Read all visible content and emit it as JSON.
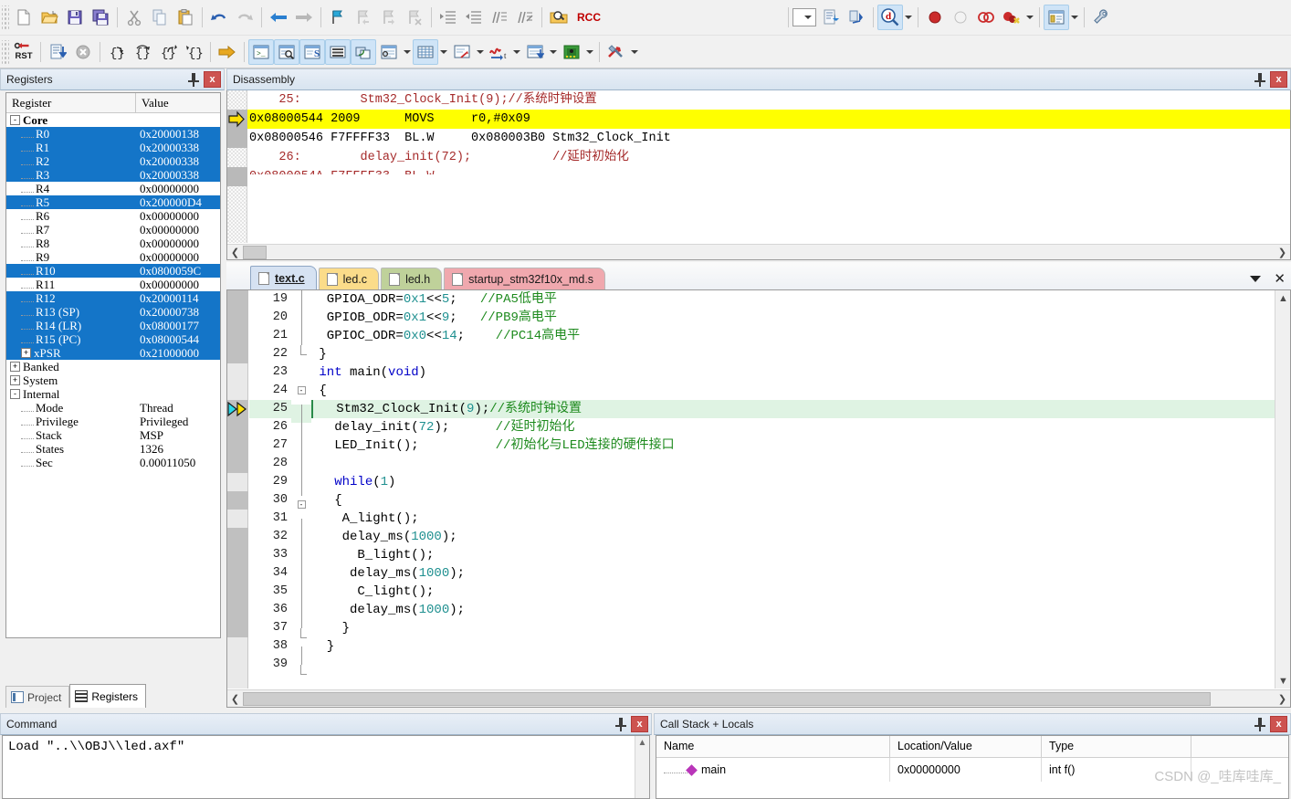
{
  "toolbar_main": {
    "groups": [
      {
        "items": [
          {
            "name": "new-file-icon",
            "label": "New"
          },
          {
            "name": "open-file-icon",
            "label": "Open"
          },
          {
            "name": "save-icon",
            "label": "Save"
          },
          {
            "name": "save-all-icon",
            "label": "Save All"
          }
        ]
      },
      {
        "items": [
          {
            "name": "cut-icon",
            "label": "Cut"
          },
          {
            "name": "copy-icon",
            "label": "Copy"
          },
          {
            "name": "paste-icon",
            "label": "Paste"
          }
        ]
      },
      {
        "items": [
          {
            "name": "undo-icon",
            "label": "Undo"
          },
          {
            "name": "redo-icon",
            "label": "Redo"
          }
        ]
      },
      {
        "items": [
          {
            "name": "navigate-back-icon",
            "label": "Back"
          },
          {
            "name": "navigate-forward-icon",
            "label": "Forward"
          }
        ]
      },
      {
        "items": [
          {
            "name": "bookmark-toggle-icon",
            "label": "Toggle Bookmark"
          },
          {
            "name": "bookmark-prev-icon",
            "label": "Previous Bookmark"
          },
          {
            "name": "bookmark-next-icon",
            "label": "Next Bookmark"
          },
          {
            "name": "bookmark-clear-icon",
            "label": "Clear All Bookmarks"
          }
        ]
      },
      {
        "items": [
          {
            "name": "indent-icon",
            "label": "Indent"
          },
          {
            "name": "outdent-icon",
            "label": "Outdent"
          },
          {
            "name": "comment-icon",
            "label": "Comment"
          },
          {
            "name": "uncomment-icon",
            "label": "Uncomment"
          }
        ]
      },
      {
        "items": [
          {
            "name": "find-in-files-icon",
            "label": "Find in Files"
          }
        ]
      }
    ],
    "search_box_value": "RCC",
    "right_group": [
      {
        "name": "code-completion-combo-icon",
        "label": "Configure"
      },
      {
        "name": "insert-breakpoint-icon",
        "label": "Insert/Remove Breakpoint"
      },
      {
        "name": "enable-breakpoint-icon",
        "label": "Enable/Disable Breakpoint"
      },
      {
        "name": "disable-all-breakpoints-icon",
        "label": "Disable All Breakpoints"
      },
      {
        "name": "kill-all-breakpoints-icon",
        "label": "Kill All Breakpoints"
      },
      {
        "name": "manage-windows-icon",
        "label": "Manage Windows"
      },
      {
        "name": "configure-target-icon",
        "label": "Configure Target"
      }
    ]
  },
  "toolbar_debug": {
    "items": [
      {
        "name": "reset-cpu-icon",
        "label": "RST",
        "active": false
      },
      {
        "name": "run-icon",
        "label": "Run",
        "active": false
      },
      {
        "name": "stop-icon",
        "label": "Stop",
        "active": false
      },
      {
        "name": "step-into-icon",
        "label": "Step",
        "active": false
      },
      {
        "name": "step-over-icon",
        "label": "Step Over",
        "active": false
      },
      {
        "name": "step-out-icon",
        "label": "Step Out",
        "active": false
      },
      {
        "name": "run-to-cursor-icon",
        "label": "Run to Cursor Line",
        "active": false
      },
      {
        "name": "show-next-statement-icon",
        "label": "Show Next Statement",
        "active": false
      },
      {
        "name": "command-window-icon",
        "label": "Command Window",
        "active": true
      },
      {
        "name": "disassembly-window-icon",
        "label": "Disassembly Window",
        "active": true
      },
      {
        "name": "symbols-window-icon",
        "label": "Symbols Window",
        "active": true
      },
      {
        "name": "registers-window-icon",
        "label": "Registers Window",
        "active": true
      },
      {
        "name": "call-stack-window-icon",
        "label": "Call Stack Window",
        "active": true
      },
      {
        "name": "watch-windows-icon",
        "label": "Watch Windows",
        "active": false
      },
      {
        "name": "memory-windows-icon",
        "label": "Memory Windows",
        "active": true
      },
      {
        "name": "serial-windows-icon",
        "label": "Serial Windows",
        "active": false
      },
      {
        "name": "analysis-windows-icon",
        "label": "Analysis Windows",
        "active": false
      },
      {
        "name": "trace-windows-icon",
        "label": "Trace Windows",
        "active": false
      },
      {
        "name": "system-viewer-icon",
        "label": "System Viewer",
        "active": false
      },
      {
        "name": "toolbox-icon",
        "label": "Debug Toolbox",
        "active": false
      }
    ]
  },
  "registers_panel": {
    "title": "Registers",
    "columns": [
      "Register",
      "Value"
    ],
    "rows": [
      {
        "name": "Core",
        "value": "",
        "group": true,
        "expander": "-",
        "indent": 0,
        "selected": false
      },
      {
        "name": "R0",
        "value": "0x20000138",
        "indent": 2,
        "selected": true
      },
      {
        "name": "R1",
        "value": "0x20000338",
        "indent": 2,
        "selected": true
      },
      {
        "name": "R2",
        "value": "0x20000338",
        "indent": 2,
        "selected": true
      },
      {
        "name": "R3",
        "value": "0x20000338",
        "indent": 2,
        "selected": true
      },
      {
        "name": "R4",
        "value": "0x00000000",
        "indent": 2,
        "selected": false
      },
      {
        "name": "R5",
        "value": "0x200000D4",
        "indent": 2,
        "selected": true
      },
      {
        "name": "R6",
        "value": "0x00000000",
        "indent": 2,
        "selected": false
      },
      {
        "name": "R7",
        "value": "0x00000000",
        "indent": 2,
        "selected": false
      },
      {
        "name": "R8",
        "value": "0x00000000",
        "indent": 2,
        "selected": false
      },
      {
        "name": "R9",
        "value": "0x00000000",
        "indent": 2,
        "selected": false
      },
      {
        "name": "R10",
        "value": "0x0800059C",
        "indent": 2,
        "selected": true
      },
      {
        "name": "R11",
        "value": "0x00000000",
        "indent": 2,
        "selected": false
      },
      {
        "name": "R12",
        "value": "0x20000114",
        "indent": 2,
        "selected": true
      },
      {
        "name": "R13 (SP)",
        "value": "0x20000738",
        "indent": 2,
        "selected": true
      },
      {
        "name": "R14 (LR)",
        "value": "0x08000177",
        "indent": 2,
        "selected": true
      },
      {
        "name": "R15 (PC)",
        "value": "0x08000544",
        "indent": 2,
        "selected": true
      },
      {
        "name": "xPSR",
        "value": "0x21000000",
        "indent": 2,
        "selected": true,
        "expander": "+"
      },
      {
        "name": "Banked",
        "value": "",
        "indent": 0,
        "expander": "+",
        "selected": false
      },
      {
        "name": "System",
        "value": "",
        "indent": 0,
        "expander": "+",
        "selected": false
      },
      {
        "name": "Internal",
        "value": "",
        "indent": 0,
        "expander": "-",
        "selected": false
      },
      {
        "name": "Mode",
        "value": "Thread",
        "indent": 2,
        "selected": false
      },
      {
        "name": "Privilege",
        "value": "Privileged",
        "indent": 2,
        "selected": false
      },
      {
        "name": "Stack",
        "value": "MSP",
        "indent": 2,
        "selected": false
      },
      {
        "name": "States",
        "value": "1326",
        "indent": 2,
        "selected": false
      },
      {
        "name": "Sec",
        "value": "0.00011050",
        "indent": 2,
        "selected": false
      }
    ]
  },
  "left_tabs": [
    {
      "label": "Project",
      "icon": "project-icon",
      "active": false
    },
    {
      "label": "Registers",
      "icon": "registers-icon",
      "active": true
    }
  ],
  "disassembly_panel": {
    "title": "Disassembly",
    "lines": [
      {
        "kind": "source",
        "text": "    25:        Stm32_Clock_Init(9);//系统时钟设置",
        "current": false
      },
      {
        "kind": "asm",
        "text": "0x08000544 2009      MOVS     r0,#0x09",
        "current": true
      },
      {
        "kind": "asm",
        "text": "0x08000546 F7FFFF33  BL.W     0x080003B0 Stm32_Clock_Init",
        "current": false
      },
      {
        "kind": "source",
        "text": "    26:        delay_init(72);           //延时初始化",
        "current": false
      }
    ]
  },
  "editor": {
    "tabs": [
      {
        "label": "text.c",
        "active": true,
        "color": "#d6e2f2"
      },
      {
        "label": "led.c",
        "active": false,
        "color": "#fbdc8a"
      },
      {
        "label": "led.h",
        "active": false,
        "color": "#bfd19a"
      },
      {
        "label": "startup_stm32f10x_md.s",
        "active": false,
        "color": "#f0a8ae"
      }
    ],
    "first_line": 19,
    "current_line": 25,
    "lines": [
      {
        "n": 19,
        "code": "  GPIOA_ODR=0x1<<5;   //PA5低电平",
        "fold": "bar"
      },
      {
        "n": 20,
        "code": "  GPIOB_ODR=0x1<<9;   //PB9高电平",
        "fold": "bar"
      },
      {
        "n": 21,
        "code": "  GPIOC_ODR=0x0<<14;    //PC14高电平",
        "fold": "bar"
      },
      {
        "n": 22,
        "code": " }",
        "fold": "end"
      },
      {
        "n": 23,
        "code": " int main(void)",
        "fold": "none"
      },
      {
        "n": 24,
        "code": " {",
        "fold": "minus"
      },
      {
        "n": 25,
        "code": "   Stm32_Clock_Init(9);//系统时钟设置",
        "fold": "bar",
        "highlight": true,
        "current": true
      },
      {
        "n": 26,
        "code": "   delay_init(72);      //延时初始化",
        "fold": "bar"
      },
      {
        "n": 27,
        "code": "   LED_Init();          //初始化与LED连接的硬件接口",
        "fold": "bar"
      },
      {
        "n": 28,
        "code": "",
        "fold": "bar"
      },
      {
        "n": 29,
        "code": "   while(1)",
        "fold": "bar"
      },
      {
        "n": 30,
        "code": "   {",
        "fold": "minus"
      },
      {
        "n": 31,
        "code": "    A_light();",
        "fold": "bar"
      },
      {
        "n": 32,
        "code": "    delay_ms(1000);",
        "fold": "bar"
      },
      {
        "n": 33,
        "code": "      B_light();",
        "fold": "bar"
      },
      {
        "n": 34,
        "code": "     delay_ms(1000);",
        "fold": "bar"
      },
      {
        "n": 35,
        "code": "      C_light();",
        "fold": "bar"
      },
      {
        "n": 36,
        "code": "     delay_ms(1000);",
        "fold": "bar"
      },
      {
        "n": 37,
        "code": "    }",
        "fold": "end"
      },
      {
        "n": 38,
        "code": "  }",
        "fold": "bar"
      },
      {
        "n": 39,
        "code": "",
        "fold": "end"
      }
    ]
  },
  "command_panel": {
    "title": "Command",
    "output": "Load \"..\\\\OBJ\\\\led.axf\""
  },
  "callstack_panel": {
    "title": "Call Stack + Locals",
    "columns": [
      "Name",
      "Location/Value",
      "Type",
      ""
    ],
    "rows": [
      {
        "name": "main",
        "location": "0x00000000",
        "type": "int f()"
      }
    ]
  },
  "watermark": "CSDN @_哇库哇库_",
  "colors": {
    "selection_blue": "#1475c8",
    "current_asm_yellow": "#ffff00",
    "current_line_green": "#dff3e3",
    "panel_header": "#d8e4f0",
    "close_red": "#cd5350"
  }
}
